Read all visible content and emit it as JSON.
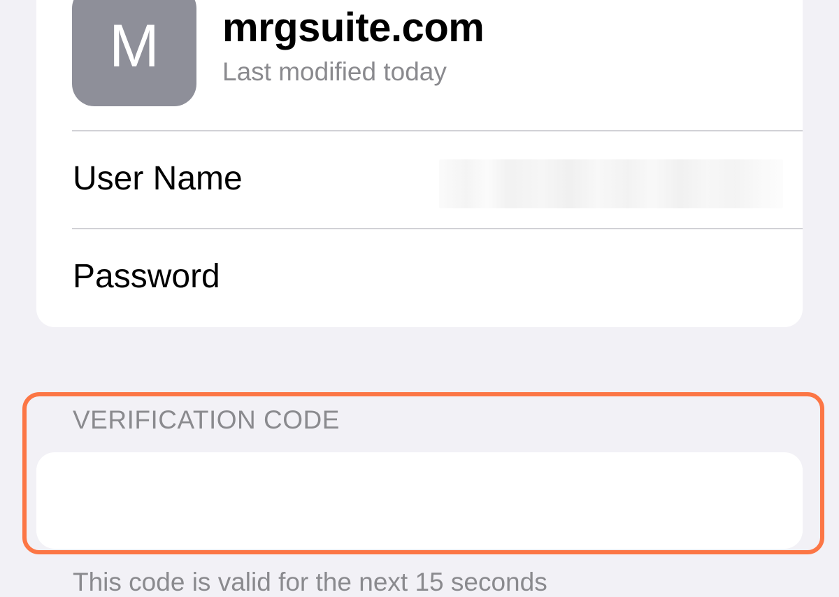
{
  "account": {
    "avatar_letter": "M",
    "site": "mrgsuite.com",
    "last_modified": "Last modified today"
  },
  "fields": {
    "username_label": "User Name",
    "username_value": "",
    "password_label": "Password"
  },
  "verification": {
    "header": "VERIFICATION CODE",
    "code": "",
    "validity_note": "This code is valid for the next 15 seconds"
  },
  "colors": {
    "background": "#f2f1f6",
    "avatar": "#8e8f99",
    "highlight": "#fc7645",
    "secondary_text": "#8a8a8e"
  }
}
